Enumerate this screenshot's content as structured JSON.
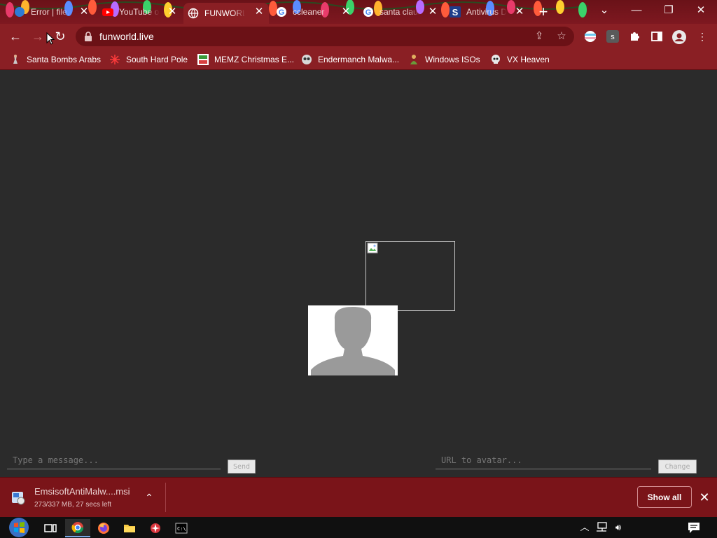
{
  "tabs": [
    {
      "title": "Error | file.io",
      "icon": "file-io-icon"
    },
    {
      "title": "YouTube o",
      "icon": "youtube-icon"
    },
    {
      "title": "FUNWORLD",
      "icon": "globe-icon",
      "active": true
    },
    {
      "title": "ccleaner",
      "icon": "google-icon"
    },
    {
      "title": "santa claus",
      "icon": "google-icon"
    },
    {
      "title": "Antivirus D",
      "icon": "s-logo-icon"
    }
  ],
  "address_bar": {
    "url": "funworld.live"
  },
  "bookmarks": [
    {
      "label": "Santa Bombs Arabs",
      "icon": "santa-icon"
    },
    {
      "label": "South Hard Pole",
      "icon": "snowflake-icon"
    },
    {
      "label": "MEMZ Christmas E...",
      "icon": "memz-icon"
    },
    {
      "label": "Endermanch Malwa...",
      "icon": "owl-icon"
    },
    {
      "label": "Windows ISOs",
      "icon": "man-icon"
    },
    {
      "label": "VX Heaven",
      "icon": "skull-icon"
    }
  ],
  "chat": {
    "message_placeholder": "Type a message...",
    "send_label": "Send",
    "avatar_placeholder": "URL to avatar...",
    "change_label": "Change"
  },
  "download": {
    "filename": "EmsisoftAntiMalw....msi",
    "status": "273/337 MB, 27 secs left",
    "show_all_label": "Show all"
  },
  "colors": {
    "theme_red": "#8a1f24",
    "tabstrip_red": "#6a1218",
    "page_bg": "#2b2b2b",
    "shelf_red": "#7a1419"
  }
}
